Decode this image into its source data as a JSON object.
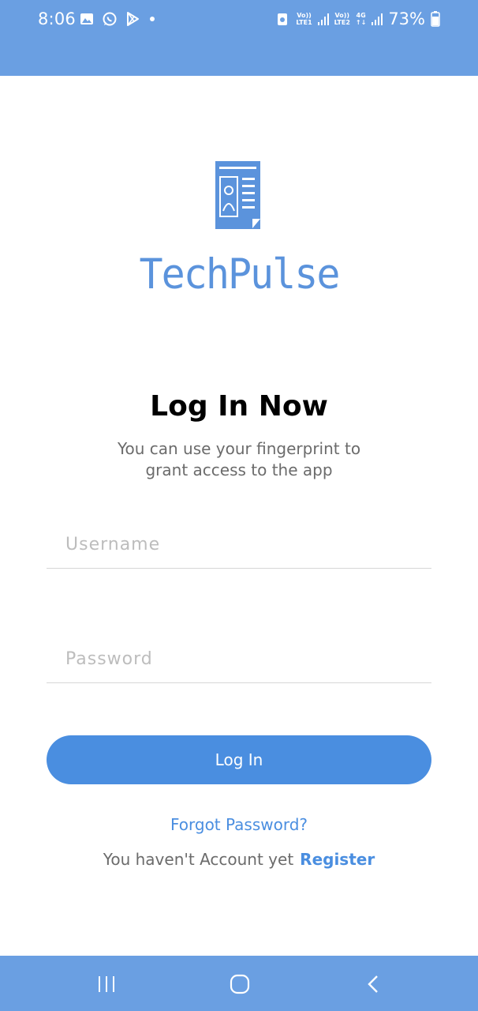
{
  "status_bar": {
    "time": "8:06",
    "left_icons": [
      "gallery-icon",
      "whatsapp-icon",
      "play-store-icon",
      "dot-icon"
    ],
    "sim1_tag_top": "Vo))",
    "sim1_tag_bottom": "LTE1",
    "sim2_tag_top": "Vo))",
    "sim2_tag_bottom": "LTE2",
    "network_type": "4G",
    "battery": "73%"
  },
  "brand": {
    "logo_icon": "id-document-icon",
    "name": "TechPulse",
    "color": "#5b93dc"
  },
  "login": {
    "title": "Log In Now",
    "subtitle_line1": "You can use your fingerprint to",
    "subtitle_line2": "grant access to the app",
    "username_placeholder": "Username",
    "password_placeholder": "Password",
    "login_button": "Log In",
    "forgot_password": "Forgot Password?",
    "no_account_text": "You haven't Account yet",
    "register_link": "Register"
  },
  "nav_bar": {
    "recent_icon": "recent-apps-icon",
    "home_icon": "home-icon",
    "back_icon": "back-icon"
  },
  "colors": {
    "bars": "#6a9fe2",
    "accent": "#4a8ee0"
  }
}
